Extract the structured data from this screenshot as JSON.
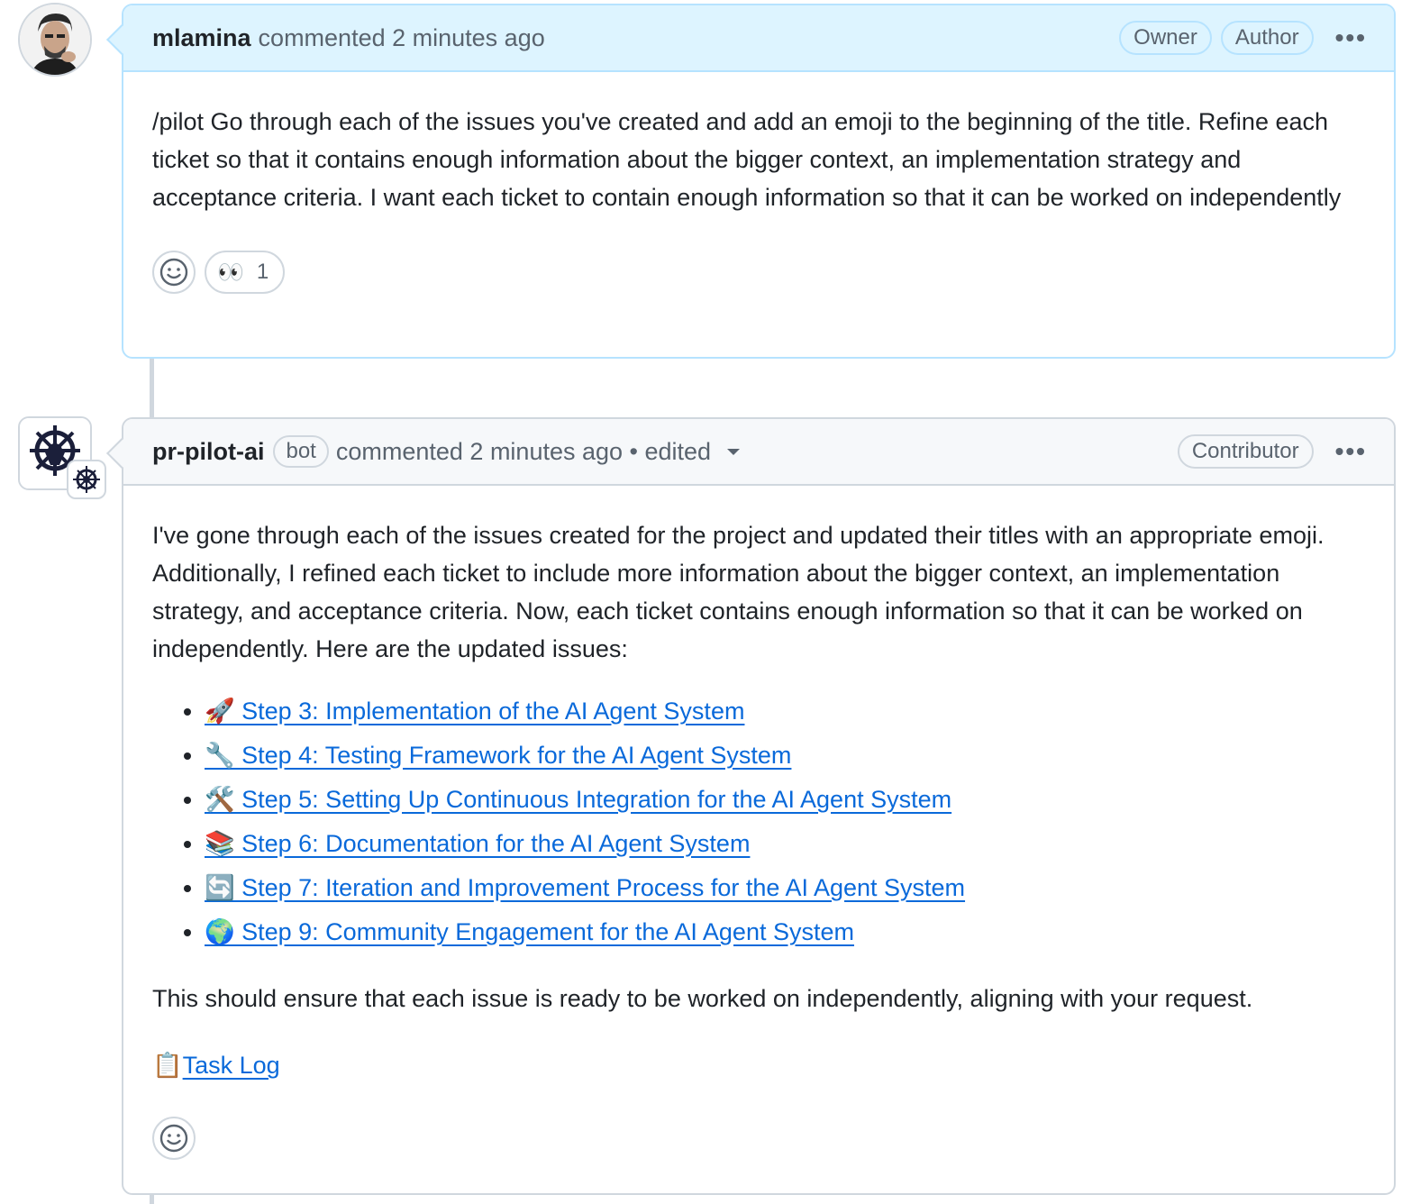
{
  "comment1": {
    "author": "mlamina",
    "meta": "commented 2 minutes ago",
    "badges": [
      "Owner",
      "Author"
    ],
    "more": "•••",
    "body": "/pilot Go through each of the issues you've created and add an emoji to the beginning of the title. Refine each ticket so that it contains enough information about the bigger context, an implementation strategy and acceptance criteria. I want each ticket to contain enough information so that it can be worked on independently",
    "reaction": {
      "emoji": "👀",
      "count": "1"
    }
  },
  "comment2": {
    "author": "pr-pilot-ai",
    "bot_label": "bot",
    "meta": "commented 2 minutes ago • edited",
    "badge": "Contributor",
    "more": "•••",
    "intro": "I've gone through each of the issues created for the project and updated their titles with an appropriate emoji. Additionally, I refined each ticket to include more information about the bigger context, an implementation strategy, and acceptance criteria. Now, each ticket contains enough information so that it can be worked on independently. Here are the updated issues:",
    "issues": [
      "🚀 Step 3: Implementation of the AI Agent System",
      "🔧 Step 4: Testing Framework for the AI Agent System",
      "🛠️ Step 5: Setting Up Continuous Integration for the AI Agent System",
      "📚 Step 6: Documentation for the AI Agent System",
      "🔄 Step 7: Iteration and Improvement Process for the AI Agent System",
      "🌍 Step 9: Community Engagement for the AI Agent System"
    ],
    "closing": "This should ensure that each issue is ready to be worked on independently, aligning with your request.",
    "task_log_icon": "📋",
    "task_log": "Task Log"
  },
  "icons": {
    "add_reaction": "smiley-icon",
    "more": "kebab-horizontal-icon",
    "dropdown": "triangle-down-icon"
  }
}
